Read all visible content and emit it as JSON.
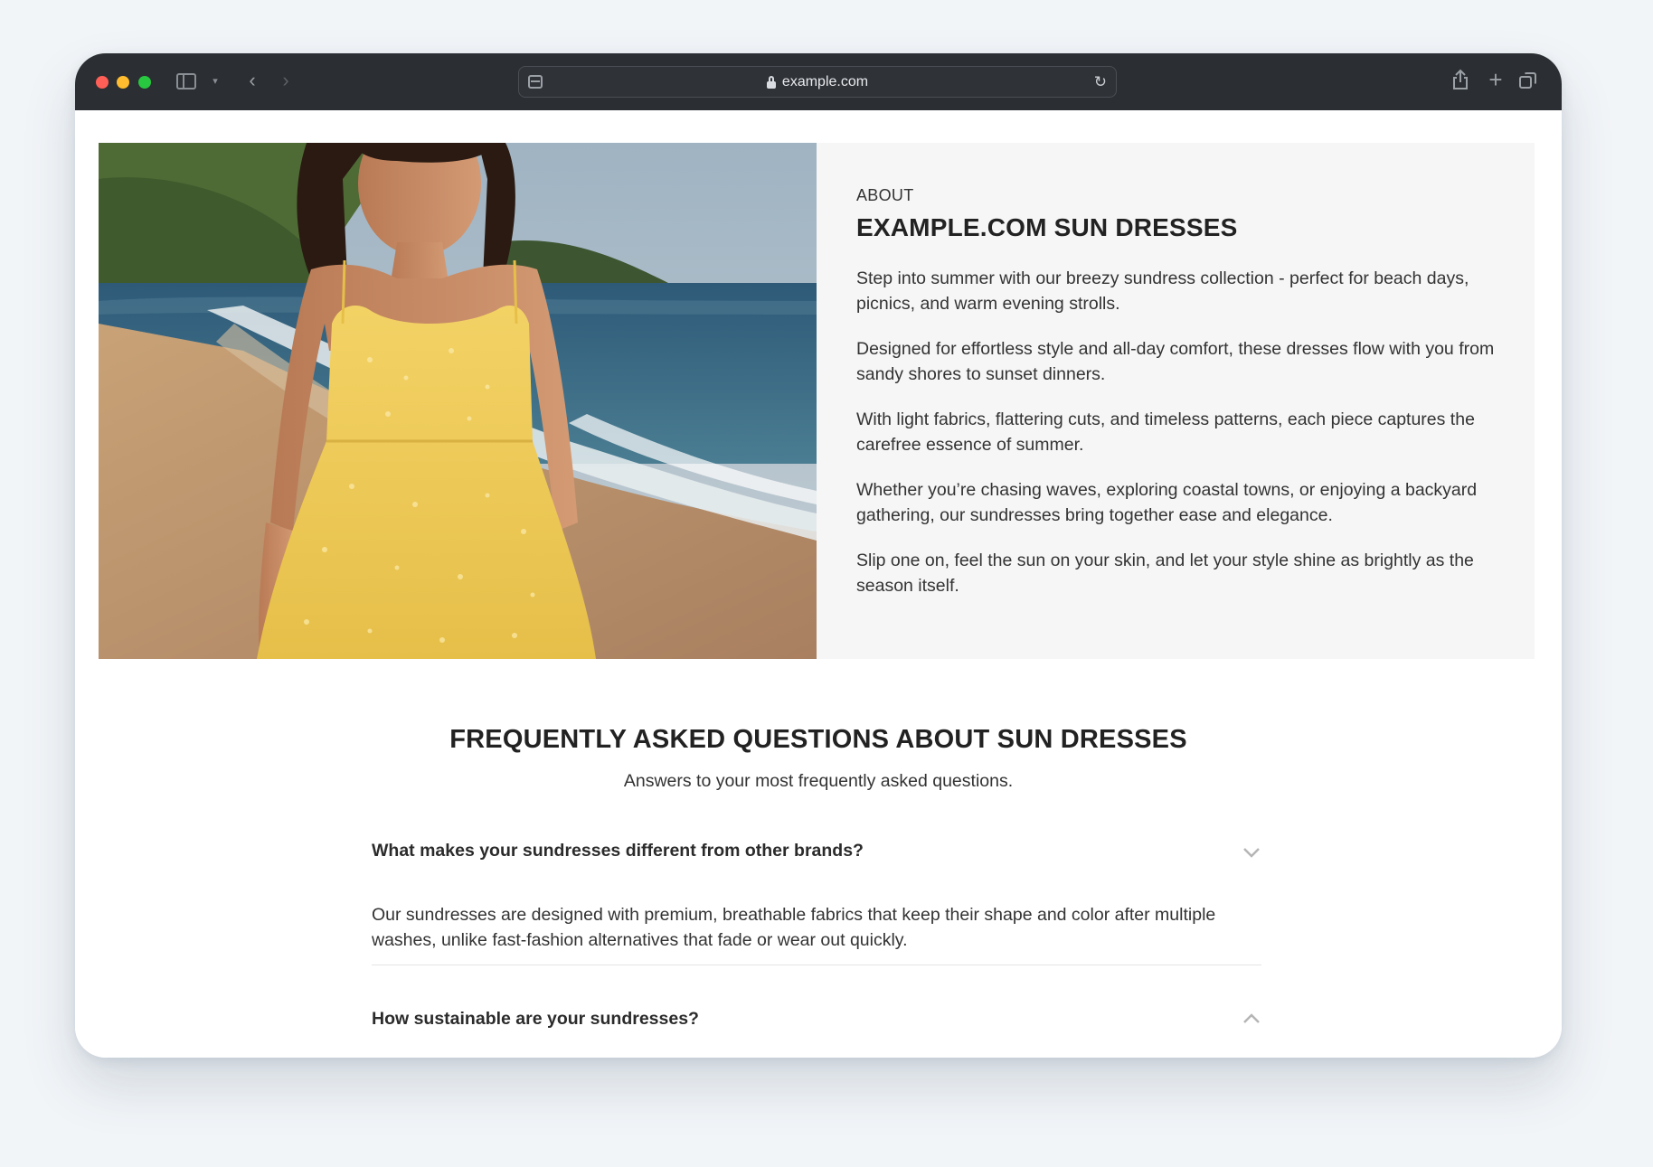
{
  "browser": {
    "url": "example.com",
    "icons": [
      "sidebar-icon",
      "chevron-down-icon",
      "back-icon",
      "forward-icon",
      "page-icon",
      "lock-icon",
      "reload-icon",
      "share-icon",
      "plus-icon",
      "tabs-icon"
    ]
  },
  "about": {
    "eyebrow": "ABOUT",
    "title": "EXAMPLE.COM SUN DRESSES",
    "paragraphs": [
      "Step into summer with our breezy sundress collection - perfect for beach days, picnics, and warm evening strolls.",
      "Designed for effortless style and all-day comfort, these dresses flow with you from sandy shores to sunset dinners.",
      "With light fabrics, flattering cuts, and timeless patterns, each piece captures the carefree essence of summer.",
      "Whether you’re chasing waves, exploring coastal towns, or enjoying a backyard gathering, our sundresses bring together ease and elegance.",
      "Slip one on, feel the sun on your skin, and let your style shine as brightly as the season itself."
    ]
  },
  "faq": {
    "title": "FREQUENTLY ASKED QUESTIONS ABOUT SUN DRESSES",
    "subtitle": "Answers to your most frequently asked questions.",
    "items": [
      {
        "question": "What makes your sundresses different from other brands?",
        "answer": "Our sundresses are designed with premium, breathable fabrics that keep their shape and color after multiple washes, unlike fast-fashion alternatives that fade or wear out quickly.",
        "expanded": true
      },
      {
        "question": "How sustainable are your sundresses?",
        "expanded": false
      }
    ]
  },
  "colors": {
    "titlebar": "#2b2e32",
    "panel": "#f6f6f6",
    "text": "#2b2b2b",
    "dress": "#f2cf5b",
    "sea": "#3e6f8c"
  }
}
